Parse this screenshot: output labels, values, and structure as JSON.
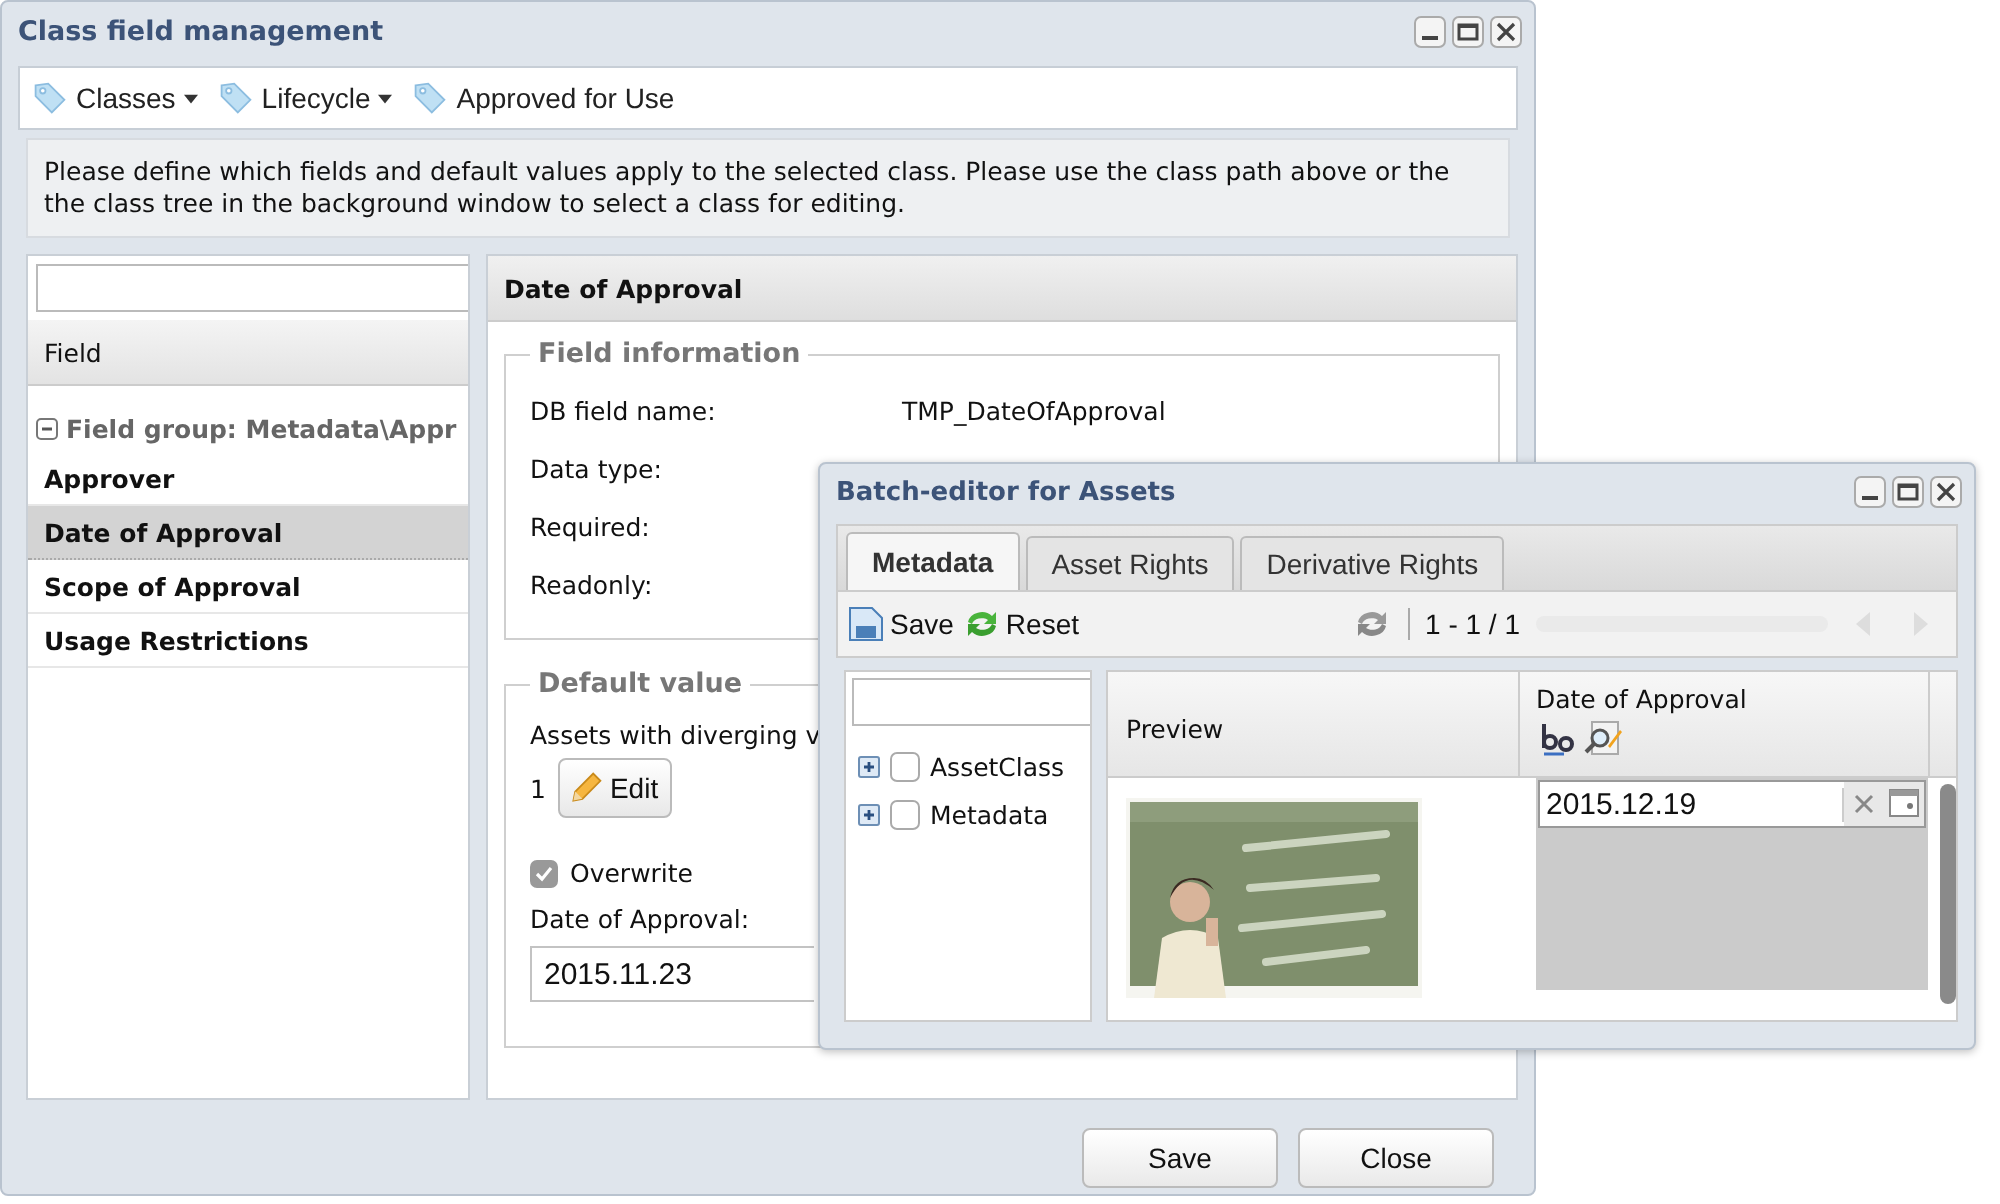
{
  "main_window": {
    "title": "Class field management",
    "toolbar": [
      {
        "label": "Classes",
        "dropdown": true
      },
      {
        "label": "Lifecycle",
        "dropdown": true
      },
      {
        "label": "Approved for Use",
        "dropdown": false
      }
    ],
    "info_text": "Please define which fields and default values apply to the selected class. Please use the class path above or the the class tree in the background window to select a class for editing.",
    "field_list": {
      "column": "Field",
      "group": {
        "label": "Field group: Metadata\\Appr",
        "expanded": true
      },
      "items": [
        {
          "label": "Approver",
          "selected": false
        },
        {
          "label": "Date of Approval",
          "selected": true
        },
        {
          "label": "Scope of Approval",
          "selected": false
        },
        {
          "label": "Usage Restrictions",
          "selected": false
        }
      ]
    },
    "detail": {
      "title": "Date of Approval",
      "field_information": {
        "legend": "Field information",
        "rows": [
          {
            "label": "DB field name:",
            "value": "TMP_DateOfApproval"
          },
          {
            "label": "Data type:"
          },
          {
            "label": "Required:"
          },
          {
            "label": "Readonly:"
          }
        ]
      },
      "default_value": {
        "legend": "Default value",
        "diverging_label": "Assets with diverging v",
        "diverging_count": "1",
        "edit_button": "Edit",
        "overwrite": {
          "label": "Overwrite",
          "checked": true
        },
        "date_label": "Date of Approval:",
        "date_value": "2015.11.23"
      }
    },
    "buttons": [
      "Save",
      "Close"
    ]
  },
  "batch_window": {
    "title": "Batch-editor for Assets",
    "tabs": [
      {
        "label": "Metadata",
        "selected": true
      },
      {
        "label": "Asset Rights",
        "selected": false
      },
      {
        "label": "Derivative Rights",
        "selected": false
      }
    ],
    "toolbar": {
      "save": "Save",
      "reset": "Reset",
      "paging": "1 - 1 / 1"
    },
    "tree": [
      {
        "label": "AssetClass",
        "checked": false
      },
      {
        "label": "Metadata",
        "checked": false
      }
    ],
    "grid": {
      "columns": [
        "Preview",
        "Date of Approval"
      ],
      "rows": [
        {
          "date_value": "2015.12.19"
        }
      ]
    }
  }
}
